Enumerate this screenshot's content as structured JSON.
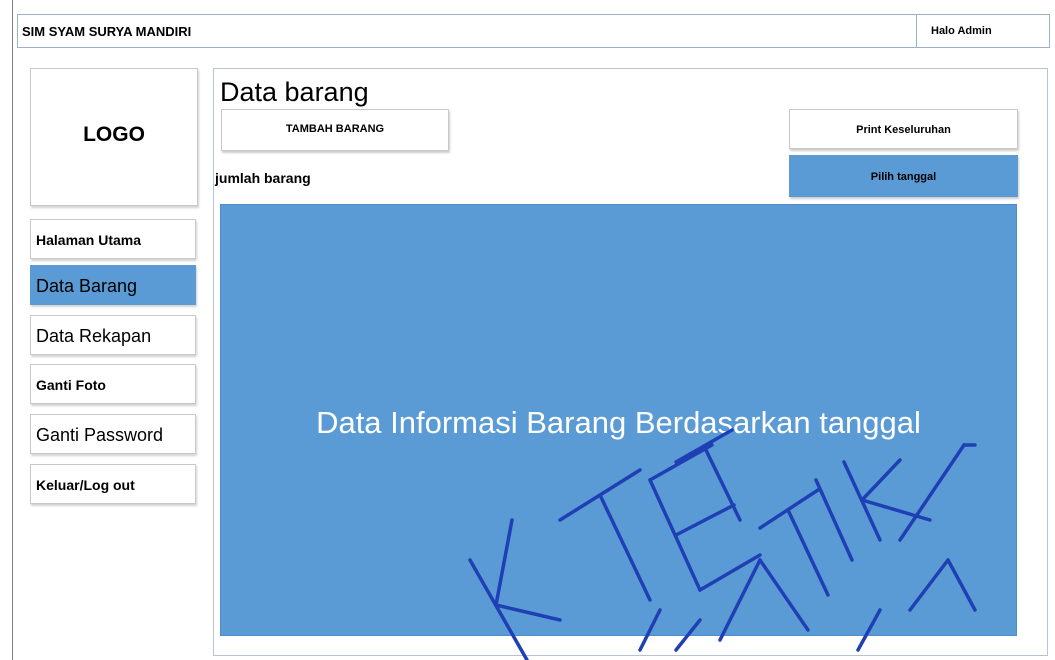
{
  "header": {
    "app_title": "SIM SYAM SURYA MANDIRI",
    "greeting": "Halo Admin"
  },
  "sidebar": {
    "logo_label": "LOGO",
    "items": [
      {
        "label": "Halaman Utama",
        "active": false
      },
      {
        "label": "Data Barang",
        "active": true
      },
      {
        "label": "Data Rekapan",
        "active": false
      },
      {
        "label": "Ganti Foto",
        "active": false
      },
      {
        "label": "Ganti Password",
        "active": false
      },
      {
        "label": "Keluar/Log out",
        "active": false
      }
    ]
  },
  "main": {
    "page_title": "Data barang",
    "add_button": "TAMBAH BARANG",
    "print_button": "Print Keseluruhan",
    "date_button": "Pilih tanggal",
    "count_label": "jumlah barang",
    "content_placeholder": "Data Informasi Barang Berdasarkan tanggal"
  },
  "colors": {
    "accent": "#5b9bd5",
    "border": "#c9c9c9",
    "watermark": "#1f3fb5"
  }
}
